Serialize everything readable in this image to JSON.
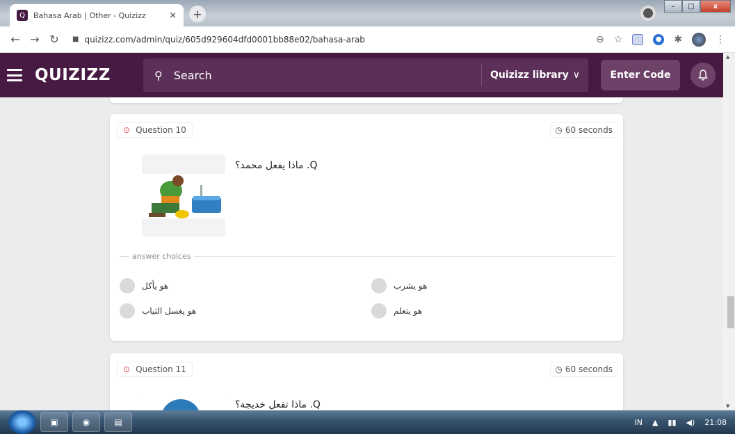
{
  "browser": {
    "tab_title": "Bahasa Arab | Other - Quizizz",
    "tab_close": "×",
    "new_tab": "+",
    "url": "quizizz.com/admin/quiz/605d929604dfd0001bb88e02/bahasa-arab",
    "win_min": "–",
    "win_max": "□",
    "win_close": "x"
  },
  "header": {
    "logo": "QUIZIZZ",
    "search_placeholder": "Search",
    "library_label": "Quizizz library",
    "library_chevron": "∨",
    "enter_code": "Enter Code"
  },
  "questions": [
    {
      "label": "Question 10",
      "time": "60 seconds",
      "text": "Q. ماذا يفعل محمد؟",
      "answer_choices_label": "answer choices",
      "choices": [
        "هو يأكل",
        "هو يشرب",
        "هو يغسل الثياب",
        "هو يتعلم"
      ]
    },
    {
      "label": "Question 11",
      "time": "60 seconds",
      "text": "Q. ماذا تفعل خديجة؟"
    }
  ],
  "taskbar": {
    "lang": "IN",
    "clock": "21:08"
  },
  "colors": {
    "brand": "#461a42",
    "search_bg": "#5b2f57",
    "button_bg": "#6e4268",
    "question_dot": "#e5484d"
  },
  "icons": [
    "hamburger-icon",
    "search-icon",
    "bell-icon",
    "clock-icon",
    "back-icon",
    "forward-icon",
    "reload-icon",
    "lock-icon",
    "zoom-icon",
    "star-icon",
    "puzzle-icon"
  ]
}
